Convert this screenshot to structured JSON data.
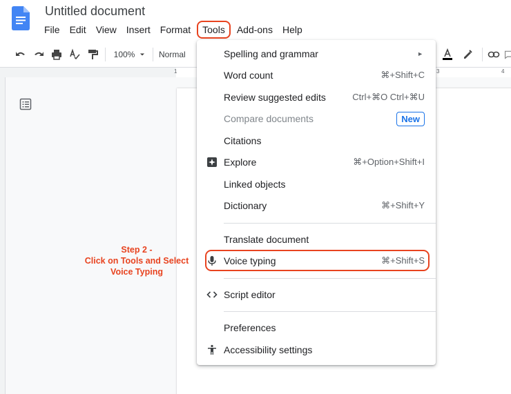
{
  "header": {
    "title": "Untitled document",
    "menus": [
      "File",
      "Edit",
      "View",
      "Insert",
      "Format",
      "Tools",
      "Add-ons",
      "Help"
    ],
    "active_menu": "Tools"
  },
  "toolbar": {
    "zoom": "100%",
    "style": "Normal",
    "icons": [
      "undo-icon",
      "redo-icon",
      "print-icon",
      "spellcheck-icon",
      "paint-format-icon",
      "text-color-icon",
      "highlight-icon",
      "link-icon"
    ]
  },
  "ruler": {
    "numbers": [
      "1",
      "3",
      "4"
    ]
  },
  "annotation": {
    "line1": "Step 2 -",
    "line2": "Click on Tools and Select",
    "line3": "Voice Typing"
  },
  "colors": {
    "accent_red": "#e8431f",
    "blue": "#1a73e8",
    "doc_blue": "#4285f4"
  },
  "tools_menu": {
    "items": [
      {
        "label": "Spelling and grammar",
        "shortcut": "",
        "arrow": "►"
      },
      {
        "label": "Word count",
        "shortcut": "⌘+Shift+C"
      },
      {
        "label": "Review suggested edits",
        "shortcut": "Ctrl+⌘O Ctrl+⌘U"
      },
      {
        "label": "Compare documents",
        "badge": "New",
        "disabled": true
      },
      {
        "label": "Citations",
        "shortcut": ""
      },
      {
        "label": "Explore",
        "shortcut": "⌘+Option+Shift+I",
        "icon": "explore-icon"
      },
      {
        "label": "Linked objects",
        "shortcut": ""
      },
      {
        "label": "Dictionary",
        "shortcut": "⌘+Shift+Y"
      },
      {
        "label": "Translate document",
        "shortcut": ""
      },
      {
        "label": "Voice typing",
        "shortcut": "⌘+Shift+S",
        "icon": "microphone-icon"
      },
      {
        "label": "Script editor",
        "shortcut": "",
        "icon": "code-icon"
      },
      {
        "label": "Preferences",
        "shortcut": ""
      },
      {
        "label": "Accessibility settings",
        "shortcut": "",
        "icon": "accessibility-icon"
      }
    ]
  }
}
